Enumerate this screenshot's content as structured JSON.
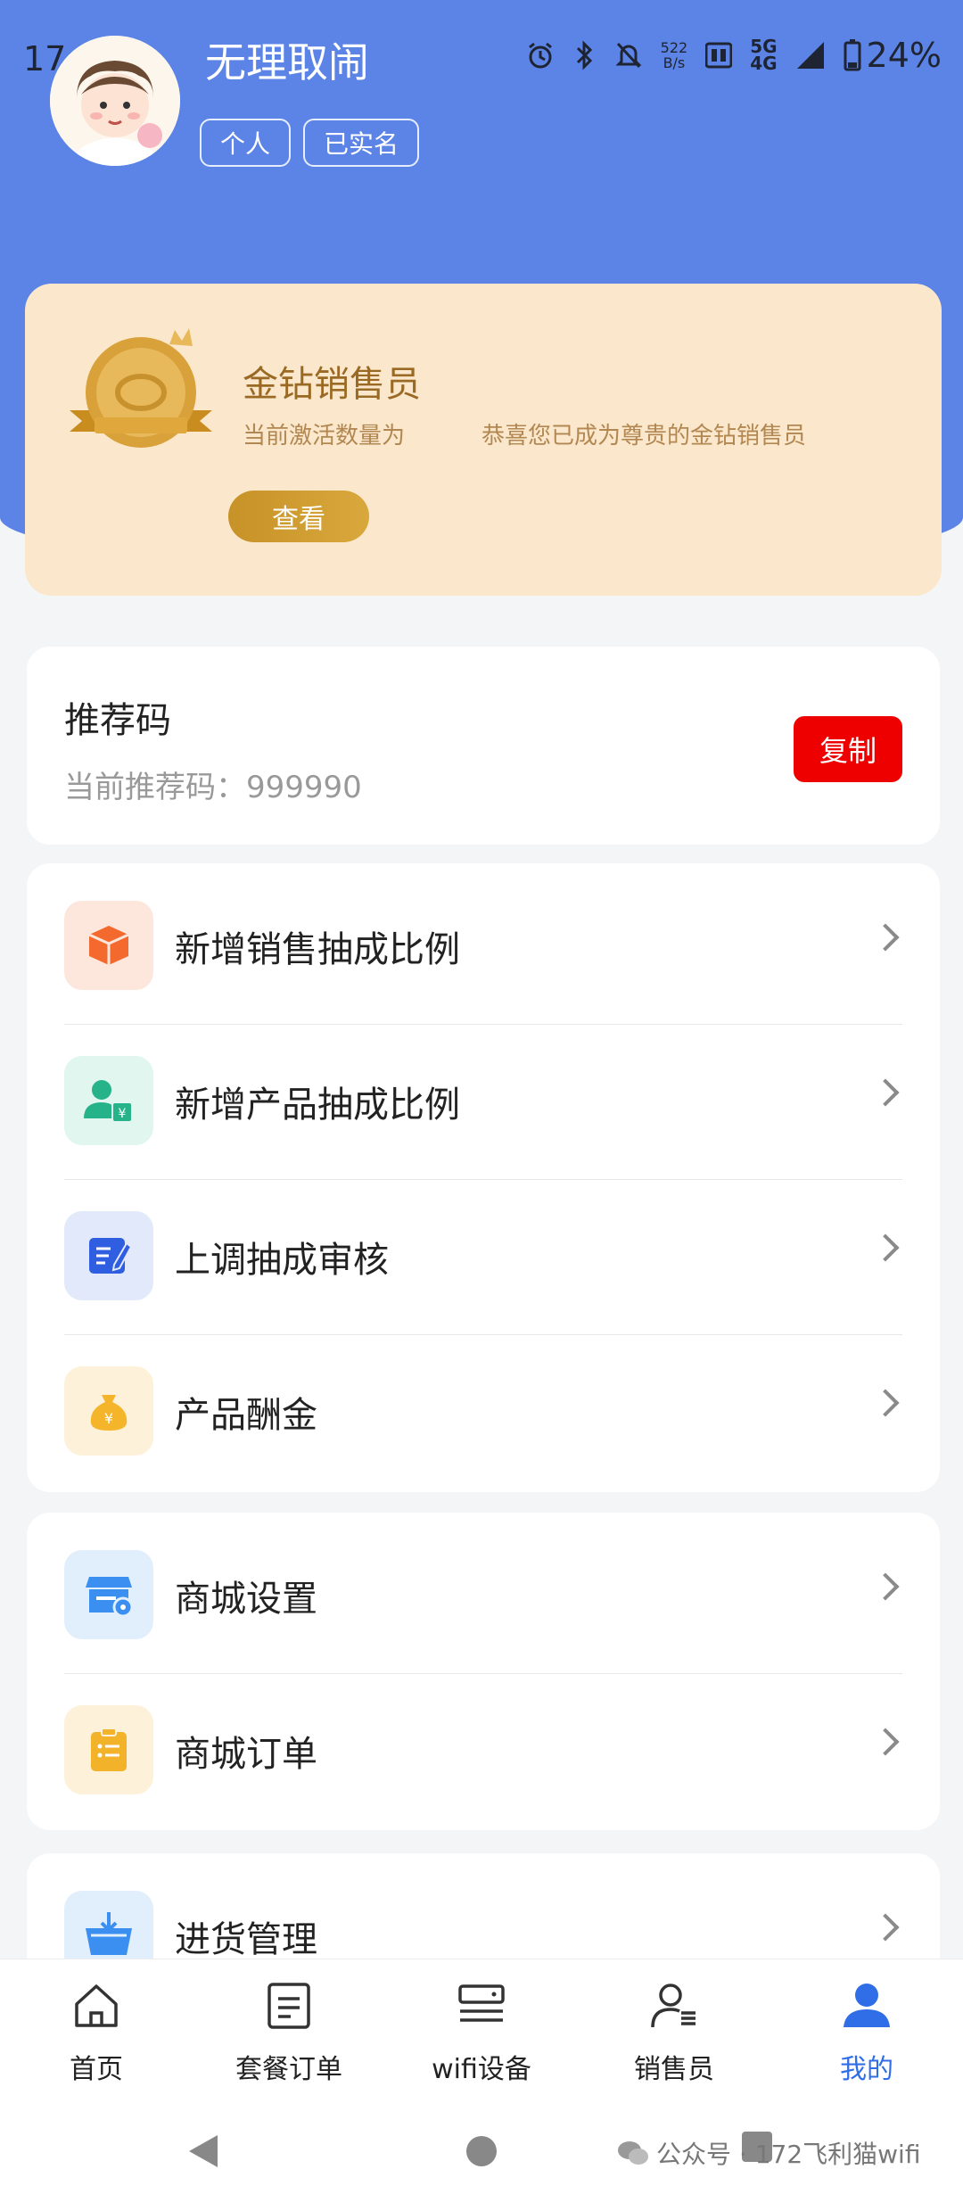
{
  "status_bar": {
    "time": "17:48",
    "speed_top": "522",
    "speed_unit": "B/s",
    "network_top": "5G",
    "network_bottom": "4G",
    "battery": "24%"
  },
  "profile": {
    "username": "无理取闹",
    "tags": [
      "个人",
      "已实名"
    ]
  },
  "level_card": {
    "title": "金钻销售员",
    "desc_prefix": "当前激活数量为",
    "desc_suffix": "恭喜您已成为尊贵的金钻销售员",
    "button_label": "查看"
  },
  "referral": {
    "title": "推荐码",
    "code_line": "当前推荐码：999990",
    "copy_label": "复制"
  },
  "menu_group_1": [
    {
      "label": "新增销售抽成比例",
      "icon": "box-icon",
      "color": "#f46a2e",
      "bg": "#fde6dc"
    },
    {
      "label": "新增产品抽成比例",
      "icon": "user-yuan-icon",
      "color": "#26b38a",
      "bg": "#e0f6ef"
    },
    {
      "label": "上调抽成审核",
      "icon": "edit-document-icon",
      "color": "#2f5fe0",
      "bg": "#e2e9fb"
    },
    {
      "label": "产品酬金",
      "icon": "money-bag-icon",
      "color": "#f5b52a",
      "bg": "#fdf1d9"
    }
  ],
  "menu_group_2": [
    {
      "label": "商城设置",
      "icon": "store-settings-icon",
      "color": "#3a8ff0",
      "bg": "#e1eefc"
    },
    {
      "label": "商城订单",
      "icon": "clipboard-icon",
      "color": "#f2b22a",
      "bg": "#fdf1d9"
    }
  ],
  "menu_group_3": [
    {
      "label": "进货管理",
      "icon": "basket-icon",
      "color": "#3a8ff0",
      "bg": "#e1eefc"
    }
  ],
  "tabbar": [
    {
      "label": "首页",
      "icon": "home-icon"
    },
    {
      "label": "套餐订单",
      "icon": "order-list-icon"
    },
    {
      "label": "wifi设备",
      "icon": "router-icon"
    },
    {
      "label": "销售员",
      "icon": "salesperson-icon"
    },
    {
      "label": "我的",
      "icon": "me-icon",
      "active": true
    }
  ],
  "watermark": "公众号 · 172飞利猫wifi",
  "colors": {
    "header_blue": "#5b84e6",
    "accent_blue": "#2f6ee6",
    "copy_red": "#ee0000",
    "gold": "#c79227"
  }
}
